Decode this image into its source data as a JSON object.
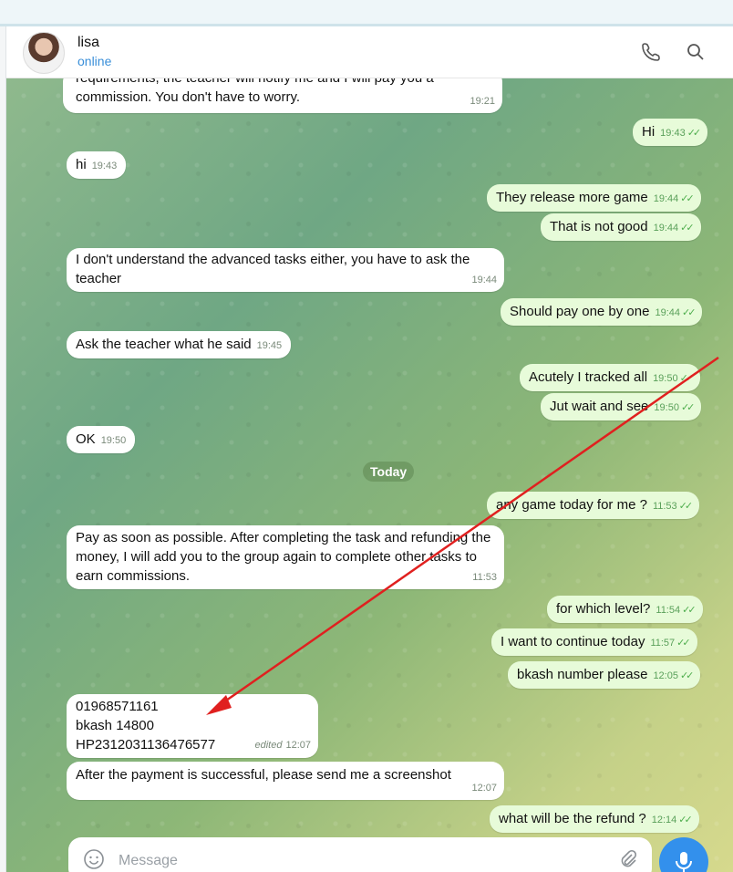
{
  "contact": {
    "name": "lisa",
    "status": "online"
  },
  "header_icons": [
    "phone-icon",
    "search-icon"
  ],
  "day_separator": "Today",
  "messages": [
    {
      "dir": "in",
      "text": "requirements, the teacher will notify me and I will pay you a commission. You don't have to worry.",
      "time": "19:21"
    },
    {
      "dir": "out",
      "text": "Hi",
      "time": "19:43"
    },
    {
      "dir": "in",
      "text": "hi",
      "time": "19:43"
    },
    {
      "dir": "out",
      "text": "They release more game",
      "time": "19:44"
    },
    {
      "dir": "out",
      "text": "That is not good",
      "time": "19:44"
    },
    {
      "dir": "in",
      "text": "I don't understand the advanced tasks either, you have to ask the teacher",
      "time": "19:44"
    },
    {
      "dir": "out",
      "text": "Should pay one by one",
      "time": "19:44"
    },
    {
      "dir": "in",
      "text": "Ask the teacher what he said",
      "time": "19:45"
    },
    {
      "dir": "out",
      "text": "Acutely I tracked all",
      "time": "19:50"
    },
    {
      "dir": "out",
      "text": "Jut wait and see",
      "time": "19:50"
    },
    {
      "dir": "in",
      "text": "OK",
      "time": "19:50"
    },
    {
      "dir": "out",
      "text": "any game today for me ?",
      "time": "11:53"
    },
    {
      "dir": "in",
      "text": "Pay as soon as possible. After completing the task and refunding the money, I will add you to the group again to complete other tasks to earn commissions.",
      "time": "11:53"
    },
    {
      "dir": "out",
      "text": "for which level?",
      "time": "11:54"
    },
    {
      "dir": "out",
      "text": "I want to continue today",
      "time": "11:57"
    },
    {
      "dir": "out",
      "text": "bkash number please",
      "time": "12:05"
    },
    {
      "dir": "in",
      "lines": [
        "01968571161",
        "bkash 14800",
        "HP2312031136476577"
      ],
      "edited_label": "edited",
      "time": "12:07"
    },
    {
      "dir": "in",
      "text": "After the payment is successful, please send me a screenshot",
      "time": "12:07"
    },
    {
      "dir": "out",
      "text": "what will be the refund ?",
      "time": "12:14"
    }
  ],
  "composer": {
    "placeholder": "Message"
  },
  "colors": {
    "accent": "#3390ec",
    "out_bubble": "#e7fbd9",
    "annotation_arrow": "#e0201f"
  }
}
